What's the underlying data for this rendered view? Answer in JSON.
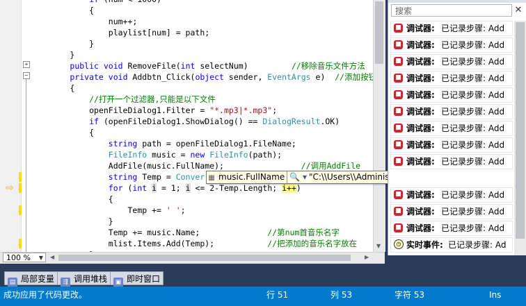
{
  "editor": {
    "lines": [
      {
        "indent": "            ",
        "parts": [
          {
            "t": "kw",
            "v": "if"
          },
          {
            "t": "",
            "v": " (num < 1000)"
          }
        ]
      },
      {
        "indent": "            ",
        "parts": [
          {
            "t": "",
            "v": "{"
          }
        ]
      },
      {
        "indent": "                ",
        "parts": [
          {
            "t": "",
            "v": "num++;"
          }
        ]
      },
      {
        "indent": "                ",
        "parts": [
          {
            "t": "",
            "v": "playlist[num] = path;"
          }
        ]
      },
      {
        "indent": "            ",
        "parts": [
          {
            "t": "",
            "v": "}"
          }
        ]
      },
      {
        "indent": "        ",
        "parts": [
          {
            "t": "",
            "v": "}"
          }
        ]
      },
      {
        "indent": "        ",
        "parts": [
          {
            "t": "kw",
            "v": "public"
          },
          {
            "t": "",
            "v": " "
          },
          {
            "t": "kw",
            "v": "void"
          },
          {
            "t": "",
            "v": " RemoveFile("
          },
          {
            "t": "kw",
            "v": "int"
          },
          {
            "t": "",
            "v": " selectNum)         "
          },
          {
            "t": "cm",
            "v": "//移除音乐文件方法"
          }
        ]
      },
      {
        "indent": "        ",
        "parts": [
          {
            "t": "kw",
            "v": "private"
          },
          {
            "t": "",
            "v": " "
          },
          {
            "t": "kw",
            "v": "void"
          },
          {
            "t": "",
            "v": " Addbtn_Click("
          },
          {
            "t": "kw",
            "v": "object"
          },
          {
            "t": "",
            "v": " sender, "
          },
          {
            "t": "ty",
            "v": "EventArgs"
          },
          {
            "t": "",
            "v": " e)  "
          },
          {
            "t": "cm",
            "v": "//添加按钮"
          }
        ]
      },
      {
        "indent": "        ",
        "parts": [
          {
            "t": "",
            "v": "{"
          }
        ]
      },
      {
        "indent": "            ",
        "parts": [
          {
            "t": "cm",
            "v": "//打开一个过滤器,只能是以下文件"
          }
        ]
      },
      {
        "indent": "            ",
        "parts": [
          {
            "t": "",
            "v": "openFileDialog1.Filter = "
          },
          {
            "t": "st",
            "v": "\"*.mp3|*.mp3\""
          },
          {
            "t": "",
            "v": ";"
          }
        ]
      },
      {
        "indent": "            ",
        "parts": [
          {
            "t": "kw",
            "v": "if"
          },
          {
            "t": "",
            "v": " (openFileDialog1.ShowDialog() == "
          },
          {
            "t": "ty",
            "v": "DialogResult"
          },
          {
            "t": "",
            "v": ".OK)"
          }
        ]
      },
      {
        "indent": "            ",
        "parts": [
          {
            "t": "",
            "v": "{"
          }
        ]
      },
      {
        "indent": "                ",
        "parts": [
          {
            "t": "kw",
            "v": "string"
          },
          {
            "t": "",
            "v": " path = openFileDialog1.FileName;"
          }
        ]
      },
      {
        "indent": "                ",
        "parts": [
          {
            "t": "ty",
            "v": "FileInfo"
          },
          {
            "t": "",
            "v": " music = "
          },
          {
            "t": "kw",
            "v": "new"
          },
          {
            "t": "",
            "v": " "
          },
          {
            "t": "ty",
            "v": "FileInfo"
          },
          {
            "t": "",
            "v": "(path);"
          }
        ]
      },
      {
        "indent": "                ",
        "parts": [
          {
            "t": "",
            "v": "AddFile(music.FullName);                "
          },
          {
            "t": "cm",
            "v": "//调用AddFile"
          }
        ]
      },
      {
        "indent": "                ",
        "parts": [
          {
            "t": "kw",
            "v": "string"
          },
          {
            "t": "",
            "v": " Temp = "
          },
          {
            "t": "ty",
            "v": "Conver"
          }
        ]
      },
      {
        "indent": "                ",
        "parts": [
          {
            "t": "kw",
            "v": "for"
          },
          {
            "t": "",
            "v": " ("
          },
          {
            "t": "kw",
            "v": "int"
          },
          {
            "t": "",
            "v": " "
          },
          {
            "t": "mi",
            "v": "i"
          },
          {
            "t": "",
            "v": " = 1; "
          },
          {
            "t": "mi",
            "v": "i"
          },
          {
            "t": "",
            "v": " <= 2-Temp.Length; "
          },
          {
            "t": "hl",
            "v": "i++"
          },
          {
            "t": "",
            "v": ")"
          }
        ]
      },
      {
        "indent": "                ",
        "parts": [
          {
            "t": "",
            "v": "{"
          }
        ]
      },
      {
        "indent": "                    ",
        "parts": [
          {
            "t": "",
            "v": "Temp += "
          },
          {
            "t": "st",
            "v": "' '"
          },
          {
            "t": "",
            "v": ";"
          }
        ]
      },
      {
        "indent": "                ",
        "parts": [
          {
            "t": "",
            "v": "}"
          }
        ]
      },
      {
        "indent": "                ",
        "parts": [
          {
            "t": "",
            "v": "Temp += music.Name;              "
          },
          {
            "t": "cm",
            "v": "//第num首音乐名字"
          }
        ]
      },
      {
        "indent": "                ",
        "parts": [
          {
            "t": "",
            "v": "mlist.Items.Add(Temp);           "
          },
          {
            "t": "cm",
            "v": "//把添加的音乐名字放在"
          }
        ]
      },
      {
        "indent": "            ",
        "parts": [
          {
            "t": "",
            "v": "}"
          }
        ]
      }
    ]
  },
  "zoom": {
    "value": "100 %"
  },
  "tooltip": {
    "name": "music.FullName",
    "magnifier": "🔍 ▾",
    "value": "\"C:\\\\Users\\\\Administrator\\\\Desktop\\\\MusicPlayer\\\\周杰伦 -"
  },
  "events_panel": {
    "search_placeholder": "搜索",
    "clear_glyph": "✕",
    "items": [
      {
        "kind": "调试器:",
        "text": "已记录步骤: Add",
        "icon": "stop-icon"
      },
      {
        "kind": "调试器:",
        "text": "已记录步骤: Add",
        "icon": "stop-icon"
      },
      {
        "kind": "调试器:",
        "text": "已记录步骤: Add",
        "icon": "stop-icon"
      },
      {
        "kind": "调试器:",
        "text": "已记录步骤: Add",
        "icon": "stop-icon"
      },
      {
        "kind": "调试器:",
        "text": "已记录步骤: Add",
        "icon": "stop-icon"
      },
      {
        "kind": "调试器:",
        "text": "已记录步骤: Add",
        "icon": "stop-icon"
      },
      {
        "kind": "调试器:",
        "text": "已记录步骤: Add",
        "icon": "stop-icon"
      },
      {
        "kind": "调试器:",
        "text": "已记录步骤: Add",
        "icon": "stop-icon"
      },
      {
        "kind": "调试器:",
        "text": "已记录步骤: Add",
        "icon": "stop-icon"
      },
      {
        "kind": "",
        "text": "",
        "icon": "hidden"
      },
      {
        "kind": "调试器:",
        "text": "已记录步骤: Add",
        "icon": "stop-icon"
      },
      {
        "kind": "调试器:",
        "text": "已记录步骤: Add",
        "icon": "stop-icon"
      },
      {
        "kind": "调试器:",
        "text": "已记录步骤: Add",
        "icon": "stop-icon"
      },
      {
        "kind": "实时事件:",
        "text": "已记录步骤: Ad",
        "icon": "clock-icon"
      }
    ]
  },
  "tabs": [
    {
      "label": "局部变量",
      "icon": "locals-icon",
      "glyph": "▤"
    },
    {
      "label": "调用堆栈",
      "icon": "call-stack-icon",
      "glyph": "⇶"
    },
    {
      "label": "即时窗口",
      "icon": "immediate-window-icon",
      "glyph": "▣"
    }
  ],
  "statusbar": {
    "message": "成功应用了代码更改。",
    "line": "行 51",
    "col": "列 53",
    "char": "字符 53",
    "mode": "Ins"
  }
}
